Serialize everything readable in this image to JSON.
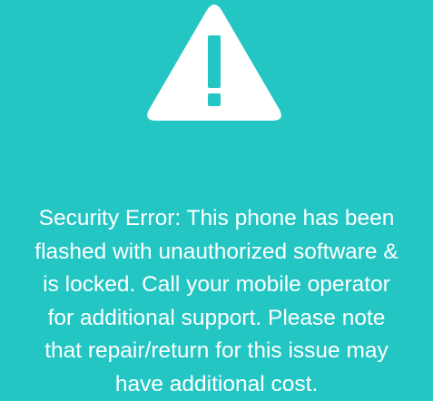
{
  "screen": {
    "background_color": "#24c6c4",
    "icon": {
      "name": "warning-icon",
      "color": "#ffffff"
    },
    "error_message": "Security Error: This phone has been\nflashed with unauthorized software &\nis locked. Call your mobile operator\nfor additional support. Please note\nthat repair/return for this issue may\nhave additional cost."
  }
}
